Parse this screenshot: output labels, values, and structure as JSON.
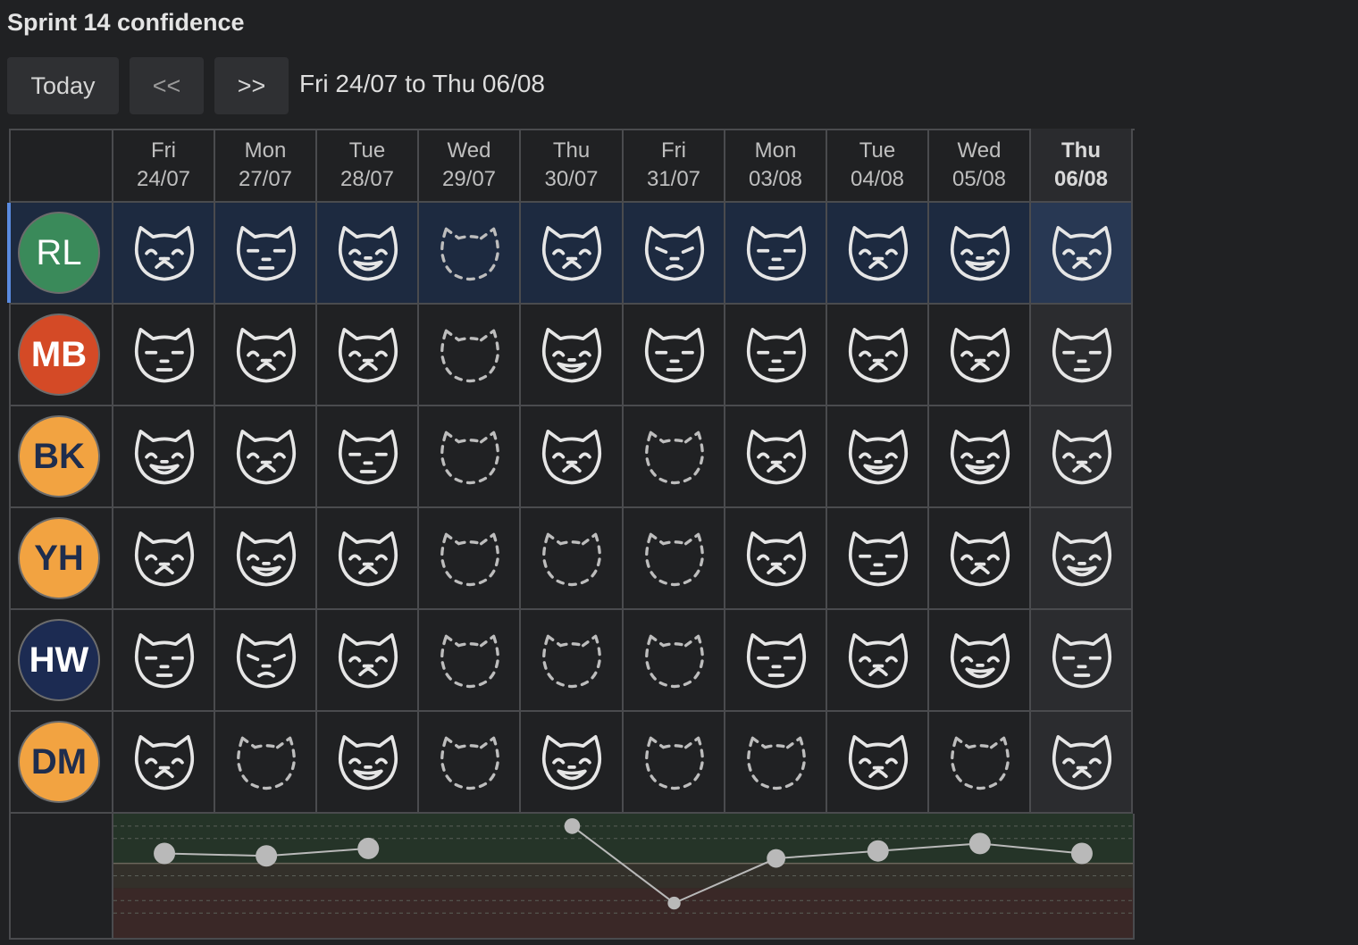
{
  "title": "Sprint 14 confidence",
  "toolbar": {
    "today_label": "Today",
    "prev_label": "<<",
    "next_label": ">>",
    "range_label": "Fri 24/07 to Thu 06/08"
  },
  "columns": [
    {
      "day": "Fri",
      "date": "24/07"
    },
    {
      "day": "Mon",
      "date": "27/07"
    },
    {
      "day": "Tue",
      "date": "28/07"
    },
    {
      "day": "Wed",
      "date": "29/07"
    },
    {
      "day": "Thu",
      "date": "30/07"
    },
    {
      "day": "Fri",
      "date": "31/07"
    },
    {
      "day": "Mon",
      "date": "03/08"
    },
    {
      "day": "Tue",
      "date": "04/08"
    },
    {
      "day": "Wed",
      "date": "05/08"
    },
    {
      "day": "Thu",
      "date": "06/08"
    }
  ],
  "today_index": 9,
  "selected_row": 0,
  "members": [
    {
      "initials": "RL",
      "color": "#3a8a5a",
      "text_color": "#ffffff",
      "moods": [
        "smile",
        "neutral",
        "grin",
        "none",
        "smile",
        "sad",
        "neutral",
        "smile",
        "grin",
        "smile"
      ]
    },
    {
      "initials": "MB",
      "color": "#d44a26",
      "text_color": "#ffffff",
      "moods": [
        "neutral",
        "smile",
        "smile",
        "none",
        "grin",
        "neutral",
        "neutral",
        "smile",
        "smile",
        "neutral"
      ]
    },
    {
      "initials": "BK",
      "color": "#f2a341",
      "text_color": "#1f2d4d",
      "moods": [
        "grin",
        "smile",
        "neutral",
        "none",
        "smile",
        "none",
        "smile",
        "grin",
        "grin",
        "smile"
      ]
    },
    {
      "initials": "YH",
      "color": "#f2a341",
      "text_color": "#1f2d4d",
      "moods": [
        "smile",
        "grin",
        "smile",
        "none",
        "none",
        "none",
        "smile",
        "neutral",
        "smile",
        "grin"
      ]
    },
    {
      "initials": "HW",
      "color": "#1c2b52",
      "text_color": "#ffffff",
      "moods": [
        "neutral",
        "sad",
        "smile",
        "none",
        "none",
        "none",
        "neutral",
        "smile",
        "grin",
        "neutral"
      ]
    },
    {
      "initials": "DM",
      "color": "#f2a341",
      "text_color": "#1f2d4d",
      "moods": [
        "smile",
        "none",
        "grin",
        "none",
        "grin",
        "none",
        "none",
        "smile",
        "none",
        "smile"
      ]
    }
  ],
  "icons": {
    "smile": "cat-smile-icon",
    "grin": "cat-grin-icon",
    "neutral": "cat-neutral-icon",
    "sad": "cat-sad-icon",
    "none": "cat-empty-icon"
  },
  "chart_data": {
    "type": "line",
    "categories": [
      "24/07",
      "27/07",
      "28/07",
      "29/07",
      "30/07",
      "31/07",
      "03/08",
      "04/08",
      "05/08",
      "06/08"
    ],
    "values": [
      3.4,
      3.3,
      3.6,
      null,
      4.5,
      1.4,
      3.2,
      3.5,
      3.8,
      3.4
    ],
    "point_size": [
      5,
      5,
      5,
      0,
      3,
      2,
      4,
      5,
      5,
      5
    ],
    "ylim": [
      0,
      5
    ],
    "bands": [
      {
        "from": 3,
        "to": 5,
        "color": "#253428"
      },
      {
        "from": 2,
        "to": 3,
        "color": "#33302a"
      },
      {
        "from": 0,
        "to": 2,
        "color": "#3a2827"
      }
    ],
    "grid": true
  }
}
